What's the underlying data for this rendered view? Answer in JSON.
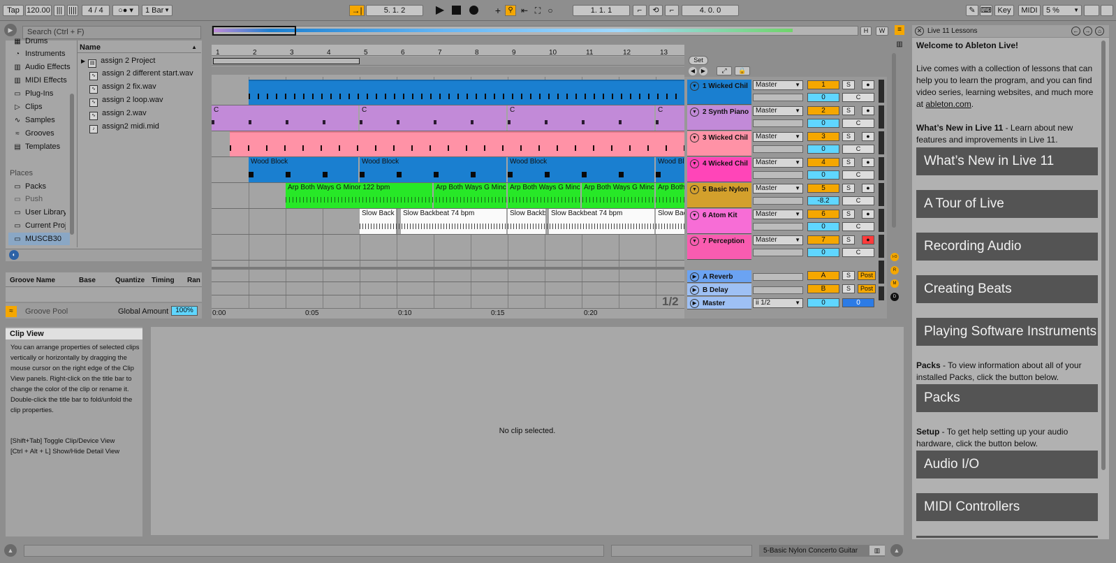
{
  "control_bar": {
    "tap": "Tap",
    "tempo": "120.00",
    "signature": "4 / 4",
    "quantize": "1 Bar",
    "arrangement_position": "5. 1. 2",
    "loop_start": "1. 1. 1",
    "loop_length": "4. 0. 0",
    "key": "Key",
    "midi": "MIDI",
    "cpu": "5 %"
  },
  "browser": {
    "search_placeholder": "Search (Ctrl + F)",
    "categories": [
      "Drums",
      "Instruments",
      "Audio Effects",
      "MIDI Effects",
      "Plug-Ins",
      "Clips",
      "Samples",
      "Grooves",
      "Templates"
    ],
    "places_label": "Places",
    "places": [
      "Packs",
      "Push",
      "User Library",
      "Current Project",
      "MUSCB30"
    ],
    "name_header": "Name",
    "files": [
      "assign 2 Project",
      "assign 2 different start.wav",
      "assign 2 fix.wav",
      "assign 2 loop.wav",
      "assign 2.wav",
      "assign2 midi.mid"
    ]
  },
  "groove_pool": {
    "headers": [
      "Groove Name",
      "Base",
      "Quantize",
      "Timing",
      "Ran"
    ],
    "title": "Groove Pool",
    "global_amount_label": "Global Amount",
    "global_amount": "100%"
  },
  "arrangement": {
    "bars": [
      "1",
      "2",
      "3",
      "4",
      "5",
      "6",
      "7",
      "8",
      "9",
      "10",
      "11",
      "12",
      "13"
    ],
    "times": [
      "0:00",
      "0:05",
      "0:10",
      "0:15",
      "0:20"
    ],
    "set_label": "Set",
    "zoom_label": "1/2",
    "h_label": "H",
    "w_label": "W"
  },
  "tracks": [
    {
      "name": "1 Wicked Chil",
      "color": "#1a7fd0",
      "output": "Master",
      "number": "1",
      "volume": "0",
      "pan": "C",
      "armed": false
    },
    {
      "name": "2 Synth Piano",
      "color": "#c28ad8",
      "output": "Master",
      "number": "2",
      "volume": "0",
      "pan": "C",
      "armed": false
    },
    {
      "name": "3 Wicked Chil",
      "color": "#ff92a6",
      "output": "Master",
      "number": "3",
      "volume": "0",
      "pan": "C",
      "armed": false
    },
    {
      "name": "4 Wicked Chil",
      "color": "#ff45b8",
      "output": "Master",
      "number": "4",
      "volume": "0",
      "pan": "C",
      "armed": false
    },
    {
      "name": "5 Basic Nylon",
      "color": "#d3a02c",
      "output": "Master",
      "number": "5",
      "volume": "-8.2",
      "pan": "C",
      "armed": false
    },
    {
      "name": "6 Atom Kit",
      "color": "#f76dd6",
      "output": "Master",
      "number": "6",
      "volume": "0",
      "pan": "C",
      "armed": false
    },
    {
      "name": "7 Perception",
      "color": "#f95cb0",
      "output": "Master",
      "number": "7",
      "volume": "0",
      "pan": "C",
      "armed": true
    }
  ],
  "returns": [
    {
      "name": "A Reverb",
      "color": "#6ba3f2",
      "letter": "A",
      "post": "Post"
    },
    {
      "name": "B Delay",
      "color": "#9ec0f4",
      "letter": "B",
      "post": "Post"
    }
  ],
  "master": {
    "name": "Master",
    "color": "#9ec0f4",
    "output": "ii 1/2",
    "volume": "0",
    "cue": "0"
  },
  "clips": {
    "piano_label": "C",
    "wood_block": "Wood Block",
    "wood_block_short": "Wood Bl",
    "arp": "Arp Both Ways G Minor 122 bpm",
    "arp_short": "Arp Both Ways G Minc",
    "arp_tiny": "Arp Both",
    "slow": "Slow Backbeat 74 bpm",
    "slow_short": "Slow Back",
    "slow_short2": "Slow Backb",
    "slow_short3": "Slow Bac"
  },
  "side_buttons": [
    "I-O",
    "R",
    "M",
    "D"
  ],
  "info_view": {
    "title": "Clip View",
    "body": "You can arrange properties of selected clips vertically or horizontally by dragging the mouse cursor on the right edge of the Clip View panels. Right-click on the title bar to change the color of the clip or rename it. Double-click the title bar to fold/unfold the clip properties.",
    "shortcut1": "[Shift+Tab] Toggle Clip/Device View",
    "shortcut2": "[Ctrl + Alt + L] Show/Hide Detail View"
  },
  "detail_view": {
    "empty": "No clip selected."
  },
  "status_bar": {
    "track_label": "5-Basic Nylon Concerto Guitar"
  },
  "lessons": {
    "title": "Live 11 Lessons",
    "welcome": "Welcome to Ableton Live!",
    "intro_pre": "Live comes with a collection of lessons that can help you to learn the program, and you can find video series, learning websites, and much more at ",
    "intro_link": "ableton.com",
    "intro_post": ".",
    "whats_new_bold": "What’s New in Live 11",
    "whats_new_text": " - Learn about new features and improvements in Live 11.",
    "btn_whats_new": "What’s New in Live 11",
    "btn_tour": "A Tour of Live",
    "btn_recording": "Recording Audio",
    "btn_beats": "Creating Beats",
    "btn_instruments": "Playing Software Instruments",
    "packs_bold": "Packs",
    "packs_text": " - To view information about all of your installed Packs, click the button below.",
    "btn_packs": "Packs",
    "setup_bold": "Setup",
    "setup_text": " - To get help setting up your audio hardware, click the button below.",
    "btn_audio_io": "Audio I/O",
    "btn_midi": "MIDI Controllers"
  }
}
